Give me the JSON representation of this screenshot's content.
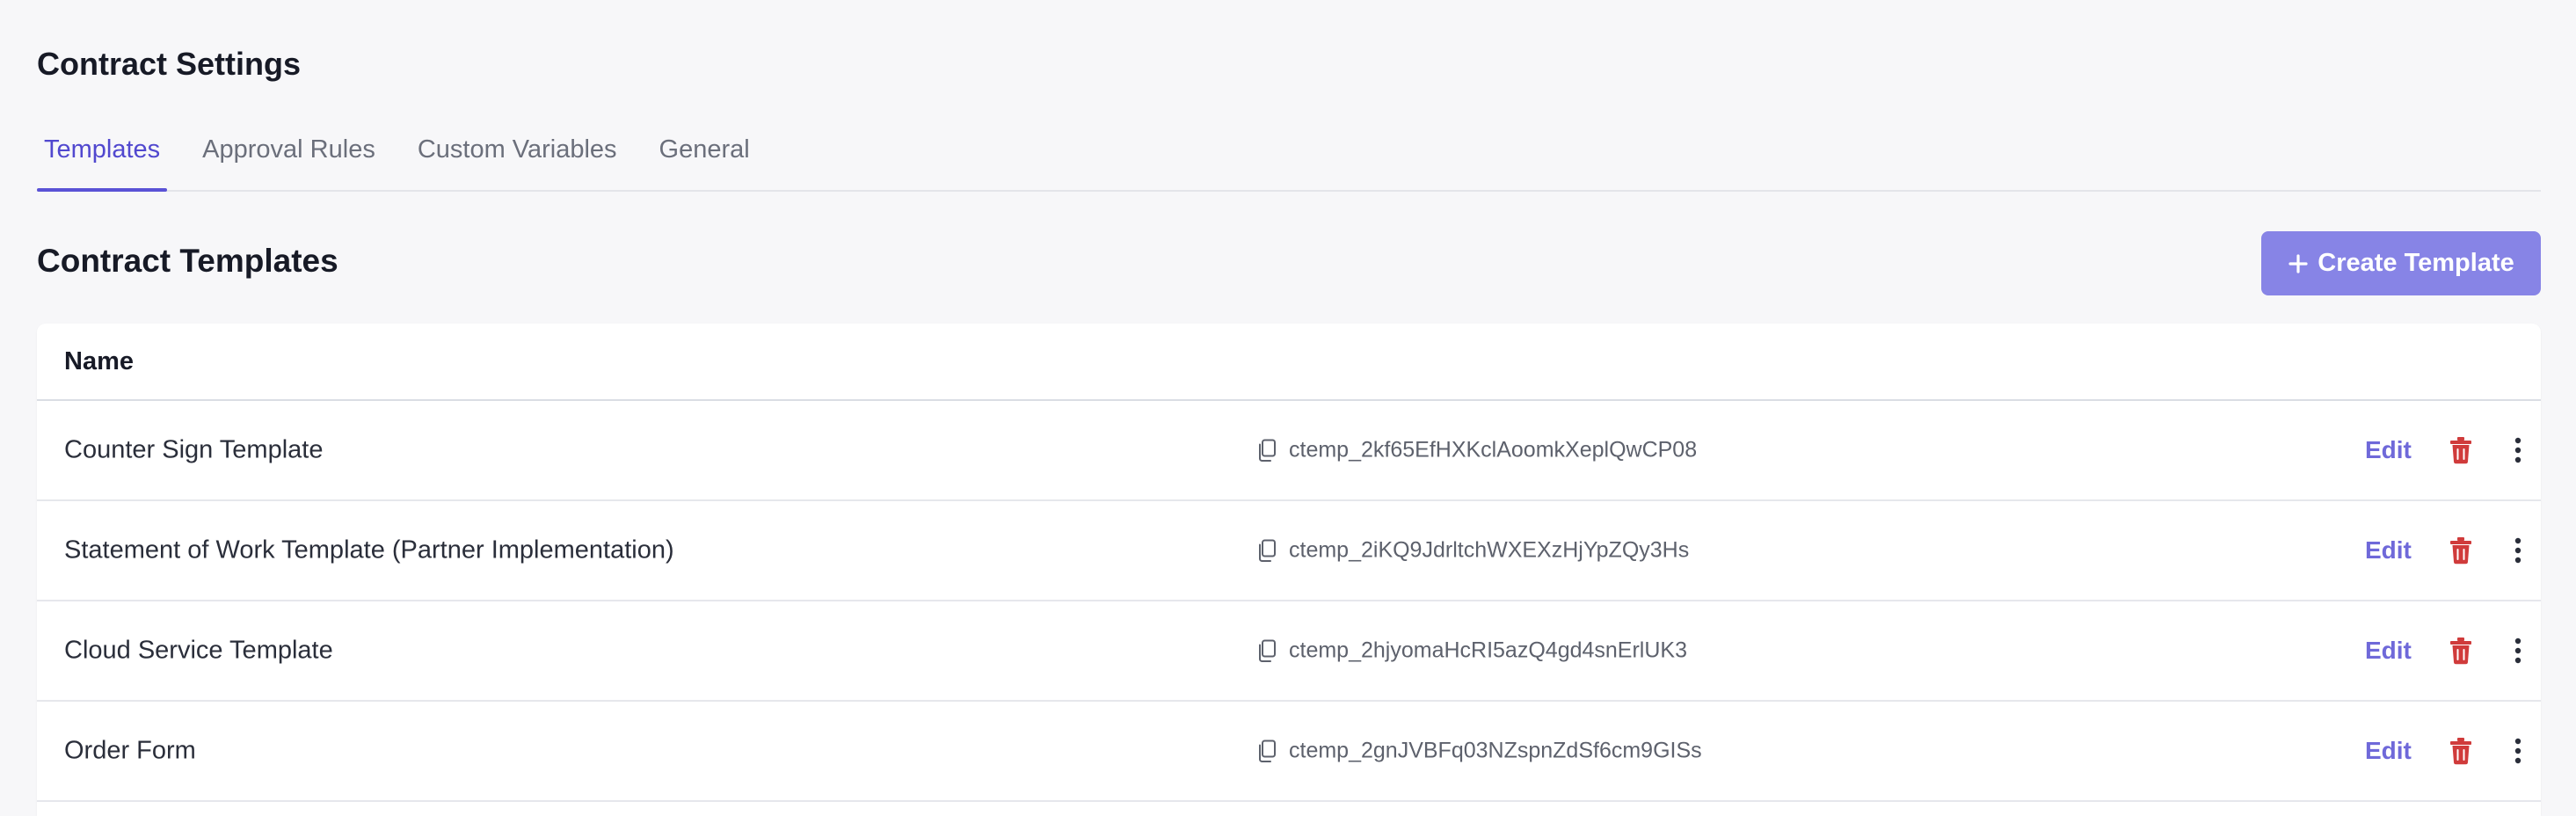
{
  "page": {
    "title": "Contract Settings"
  },
  "tabs": [
    {
      "label": "Templates",
      "active": true
    },
    {
      "label": "Approval Rules",
      "active": false
    },
    {
      "label": "Custom Variables",
      "active": false
    },
    {
      "label": "General",
      "active": false
    }
  ],
  "section": {
    "title": "Contract Templates",
    "create_label": "Create Template"
  },
  "table": {
    "header_name": "Name",
    "rows": [
      {
        "name": "Counter Sign Template",
        "id": "ctemp_2kf65EfHXKclAoomkXeplQwCP08",
        "edit": "Edit"
      },
      {
        "name": "Statement of Work Template (Partner Implementation)",
        "id": "ctemp_2iKQ9JdrltchWXEXzHjYpZQy3Hs",
        "edit": "Edit"
      },
      {
        "name": "Cloud Service Template",
        "id": "ctemp_2hjyomaHcRI5azQ4gd4snErlUK3",
        "edit": "Edit"
      },
      {
        "name": "Order Form",
        "id": "ctemp_2gnJVBFq03NZspnZdSf6cm9GISs",
        "edit": "Edit"
      }
    ]
  },
  "colors": {
    "accent": "#5a52d6",
    "button_bg": "#8784e6",
    "edit_text": "#6f69d9",
    "danger": "#d03b3b",
    "background": "#f7f7f9"
  },
  "icons": {
    "create": "plus-icon",
    "copy": "copy-icon",
    "delete": "trash-icon",
    "more": "more-vertical-icon"
  }
}
